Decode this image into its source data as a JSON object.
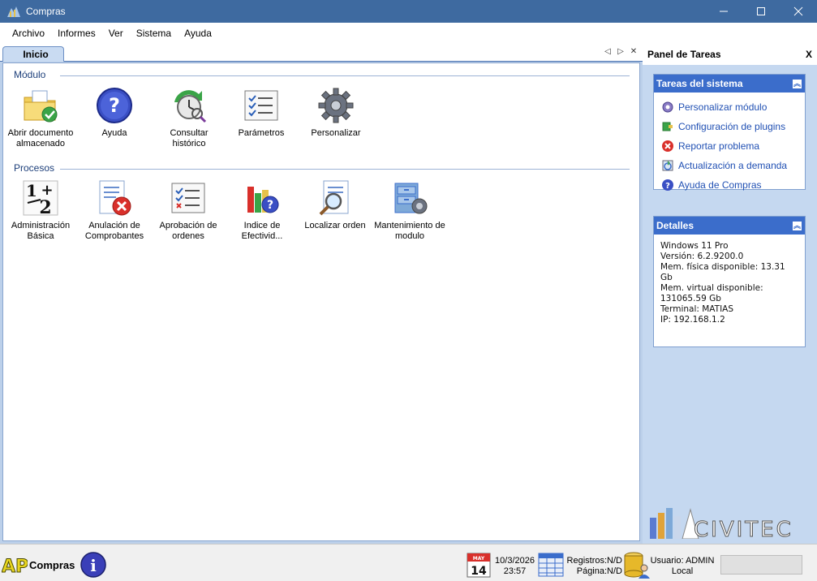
{
  "window": {
    "title": "Compras"
  },
  "menu": [
    "Archivo",
    "Informes",
    "Ver",
    "Sistema",
    "Ayuda"
  ],
  "tab": {
    "label": "Inicio"
  },
  "groups": {
    "modulo": {
      "title": "Módulo",
      "items": [
        {
          "l1": "Abrir documento",
          "l2": "almacenado",
          "icon": "folder-check-icon"
        },
        {
          "l1": "Ayuda",
          "l2": "",
          "icon": "help-icon"
        },
        {
          "l1": "Consultar",
          "l2": "histórico",
          "icon": "history-clock-icon"
        },
        {
          "l1": "Parámetros",
          "l2": "",
          "icon": "checklist-icon"
        },
        {
          "l1": "Personalizar",
          "l2": "",
          "icon": "gear-icon"
        }
      ]
    },
    "procesos": {
      "title": "Procesos",
      "items": [
        {
          "l1": "Administración",
          "l2": "Básica",
          "icon": "numbers-icon"
        },
        {
          "l1": "Anulación de",
          "l2": "Comprobantes",
          "icon": "document-cancel-icon"
        },
        {
          "l1": "Aprobación de",
          "l2": "ordenes",
          "icon": "approval-list-icon"
        },
        {
          "l1": "Indice de",
          "l2": "Efectivid...",
          "icon": "bar-chart-help-icon"
        },
        {
          "l1": "Localizar orden",
          "l2": "",
          "icon": "document-search-icon"
        },
        {
          "l1": "Mantenimiento de",
          "l2": "modulo",
          "icon": "cabinet-gear-icon"
        }
      ]
    }
  },
  "task_panel": {
    "title": "Panel de Tareas",
    "close": "X",
    "system_tasks": {
      "title": "Tareas del sistema",
      "items": [
        {
          "label": "Personalizar módulo",
          "icon": "gear-small-icon"
        },
        {
          "label": "Configuración de plugins",
          "icon": "plugin-icon"
        },
        {
          "label": "Reportar problema",
          "icon": "error-icon"
        },
        {
          "label": "Actualización a demanda",
          "icon": "update-icon"
        },
        {
          "label": "Ayuda de Compras",
          "icon": "help-small-icon"
        }
      ]
    },
    "details": {
      "title": "Detalles",
      "lines": [
        "Windows 11 Pro",
        "Versión: 6.2.9200.0",
        "Mem. física disponible: 13.31 Gb",
        "Mem. virtual disponible:",
        "131065.59 Gb",
        "Terminal: MATIAS",
        "IP: 192.168.1.2"
      ]
    },
    "brand": "CIVITEC"
  },
  "status": {
    "logo": "API",
    "app_name": "Compras",
    "calendar_month": "MAY",
    "calendar_day": "14",
    "date": "10/3/2026",
    "time": "23:57",
    "records": "Registros:N/D",
    "page": "Página:N/D",
    "user": "Usuario: ADMIN",
    "location": "Local"
  }
}
